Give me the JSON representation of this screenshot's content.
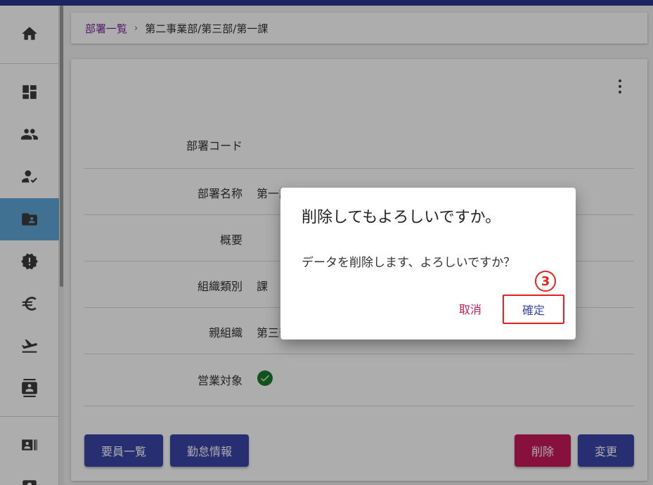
{
  "breadcrumb": {
    "root": "部署一覧",
    "separator": "›",
    "current": "第二事業部/第三部/第一課"
  },
  "sidebar": {
    "items": [
      {
        "icon": "home-icon"
      },
      {
        "icon": "dashboard-icon"
      },
      {
        "icon": "people-icon"
      },
      {
        "icon": "person-check-icon"
      },
      {
        "icon": "department-folder-icon",
        "active": true
      },
      {
        "icon": "alert-badge-icon"
      },
      {
        "icon": "euro-icon"
      },
      {
        "icon": "flight-takeoff-icon"
      },
      {
        "icon": "contact-book-icon"
      },
      {
        "icon": "id-card-icon"
      },
      {
        "icon": "account-box-icon"
      }
    ],
    "active_color": "#5fa7d9"
  },
  "details": {
    "rows": [
      {
        "label": "部署コード",
        "value": ""
      },
      {
        "label": "部署名称",
        "value": "第一課"
      },
      {
        "label": "概要",
        "value": ""
      },
      {
        "label": "組織類別",
        "value": "課"
      },
      {
        "label": "親組織",
        "value": "第三部"
      },
      {
        "label": "営業対象",
        "value": ""
      }
    ],
    "sales_target_checked": true
  },
  "actions": {
    "members_list": "要員一覧",
    "attendance_info": "勤怠情報",
    "delete": "削除",
    "change": "変更"
  },
  "dialog": {
    "title": "削除してもよろしいですか。",
    "message": "データを削除します、よろしいですか？",
    "cancel": "取消",
    "confirm": "確定",
    "step_marker": "3"
  },
  "colors": {
    "primary": "#3a46a8",
    "danger": "#c8195a",
    "topbar": "#2b3592",
    "highlight": "#ee1c1c"
  }
}
